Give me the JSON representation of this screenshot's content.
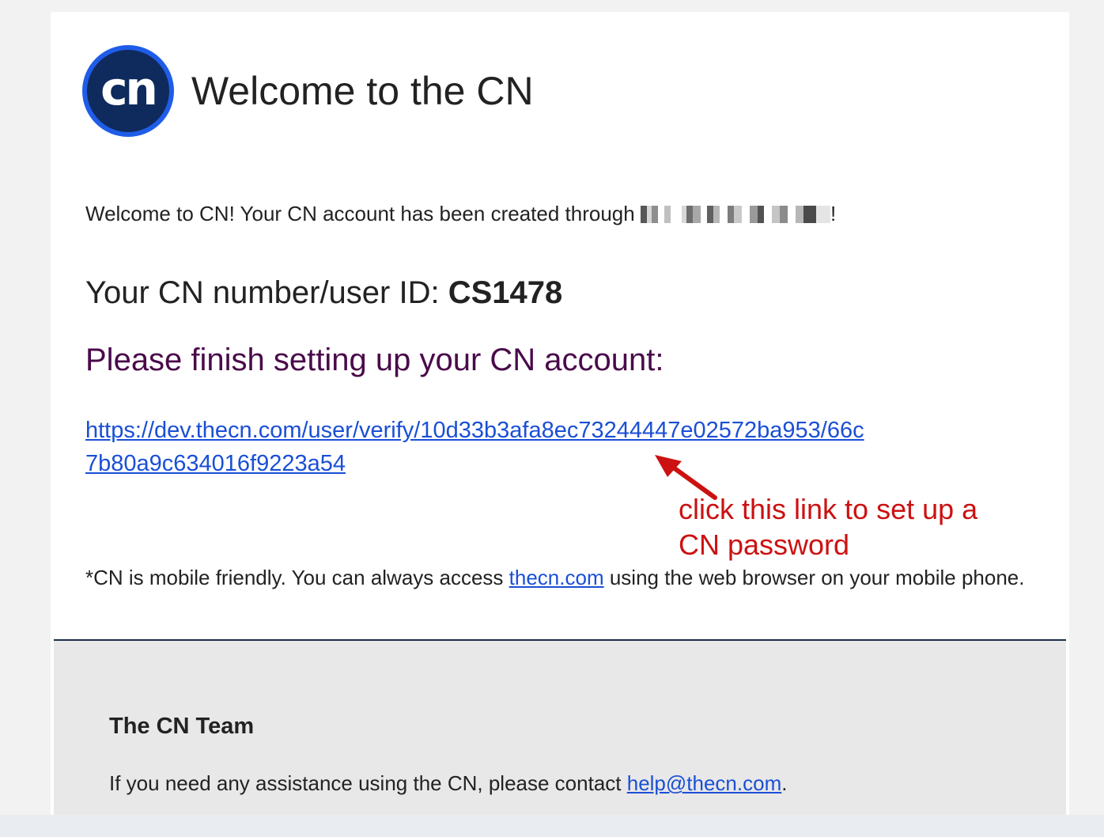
{
  "header": {
    "logo_text": "cn",
    "title": "Welcome to the CN"
  },
  "intro": {
    "text": "Welcome to CN! Your CN account has been created through ",
    "trailing": "!"
  },
  "user_id": {
    "label": "Your CN number/user ID: ",
    "value": "CS1478"
  },
  "finish_heading": "Please finish setting up your CN account:",
  "verify_link": "https://dev.thecn.com/user/verify/10d33b3afa8ec73244447e02572ba953/66c7b80a9c634016f9223a54",
  "annotation": "click this link to set up a CN password",
  "mobile_note": {
    "before": "*CN is mobile friendly. You can always access ",
    "link": "thecn.com",
    "after": " using the web browser on your mobile phone."
  },
  "footer": {
    "team": "The CN Team",
    "help_before": "If you need any assistance using the CN, please contact ",
    "help_email": "help@thecn.com",
    "help_after": "."
  },
  "colors": {
    "link": "#1a4fd6",
    "heading_purple": "#4a0a4a",
    "annotation_red": "#cc1111",
    "logo_ring": "#1f5de8",
    "logo_fill": "#0f2a5c",
    "footer_bg": "#e8e8e8"
  }
}
